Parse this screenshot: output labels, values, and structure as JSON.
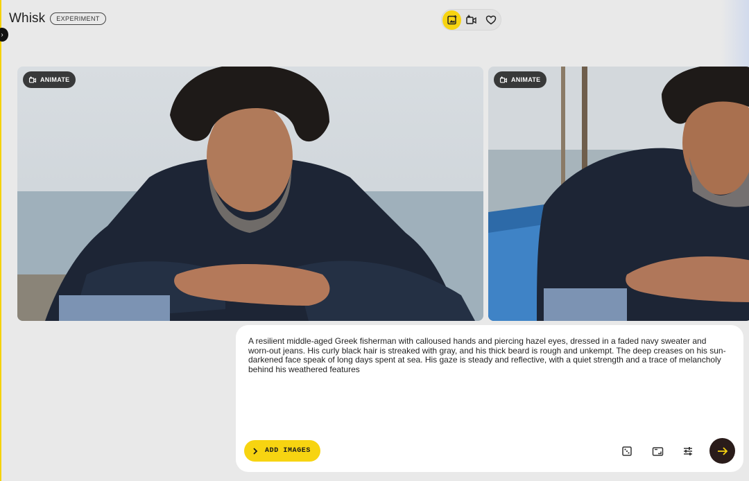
{
  "app": {
    "title": "Whisk",
    "badge": "EXPERIMENT"
  },
  "mode_switch": {
    "items": [
      "image-icon",
      "video-icon",
      "heart-icon"
    ],
    "active": "image-icon"
  },
  "gallery": {
    "cards": [
      {
        "action_label": "ANIMATE",
        "icon": "video-icon"
      },
      {
        "action_label": "ANIMATE",
        "icon": "video-icon"
      }
    ]
  },
  "prompt": {
    "text": "A resilient middle-aged Greek fisherman with calloused hands and piercing hazel eyes, dressed in a faded navy sweater and worn-out jeans. His curly black hair is streaked with gray, and his thick beard is rough and unkempt. The deep creases on his sun-darkened face speak of long days spent at sea. His gaze is steady and reflective, with a quiet strength and a trace of melancholy behind his weathered features",
    "add_images_label": "ADD IMAGES",
    "tools": [
      "dice-icon",
      "aspect-ratio-icon",
      "settings-sliders-icon"
    ],
    "submit_icon": "arrow-right-icon"
  },
  "colors": {
    "accent": "#f7d411",
    "background": "#e9e9e9",
    "submit": "#2a1c1a"
  }
}
